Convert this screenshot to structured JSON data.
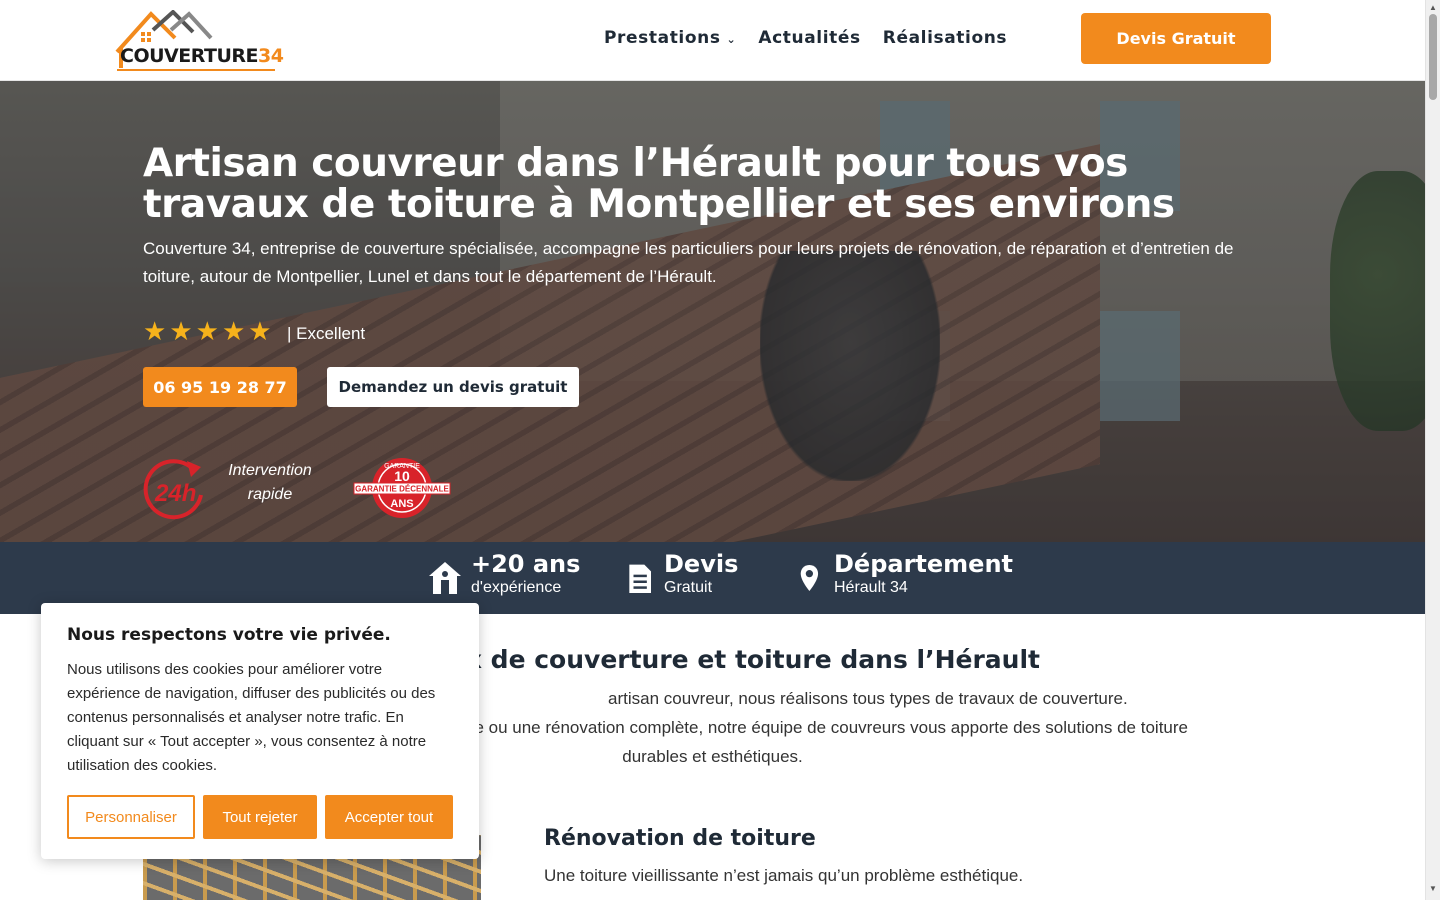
{
  "header": {
    "logo": {
      "text": "COUVERTURE",
      "number": "34"
    },
    "nav": [
      {
        "label": "Prestations",
        "has_dropdown": true
      },
      {
        "label": "Actualités"
      },
      {
        "label": "Réalisations"
      }
    ],
    "cta_label": "Devis Gratuit",
    "accent_color": "#f28a1d"
  },
  "hero": {
    "title": "Artisan couvreur dans l’Hérault pour tous vos travaux de toiture à Montpellier et ses environs",
    "subtitle": "Couverture 34, entreprise de couverture spécialisée, accompagne les particuliers pour leurs projets de rénovation, de réparation et d’entretien de toiture, autour de Montpellier, Lunel et dans tout le département de l’Hérault.",
    "rating": {
      "stars": 5,
      "max": 5,
      "label": "| Excellent"
    },
    "phone_button": "06 95 19 28 77",
    "quote_button": "Demandez un devis gratuit",
    "badge_24h": "24h",
    "intervention_text": "Intervention rapide",
    "garantie": {
      "top": "GARANTIE",
      "number": "10",
      "band": "GARANTIE DÉCENNALE",
      "bottom": "ANS"
    }
  },
  "stats": [
    {
      "icon": "house-icon",
      "title": "+20 ans",
      "subtitle": "d'expérience"
    },
    {
      "icon": "document-icon",
      "title": "Devis",
      "subtitle": "Gratuit"
    },
    {
      "icon": "location-pin-icon",
      "title": "Département",
      "subtitle": "Hérault 34"
    }
  ],
  "main": {
    "section_title": "ux de couverture et toiture dans l’Hérault",
    "section_text_lines": [
      "artisan couvreur, nous réalisons tous types de travaux de couverture.",
      "uelle ou une rénovation complète, notre équipe de couvreurs vous apporte des solutions de toiture",
      "durables et esthétiques."
    ],
    "renovation_title": "Rénovation de toiture",
    "renovation_text": "Une toiture vieillissante n’est jamais qu’un problème esthétique."
  },
  "cookie": {
    "title": "Nous respectons votre vie privée.",
    "text": "Nous utilisons des cookies pour améliorer votre expérience de navigation, diffuser des publicités ou des contenus personnalisés et analyser notre trafic. En cliquant sur « Tout accepter », vous consentez à notre utilisation des cookies.",
    "customize_label": "Personnaliser",
    "reject_label": "Tout rejeter",
    "accept_label": "Accepter tout"
  }
}
